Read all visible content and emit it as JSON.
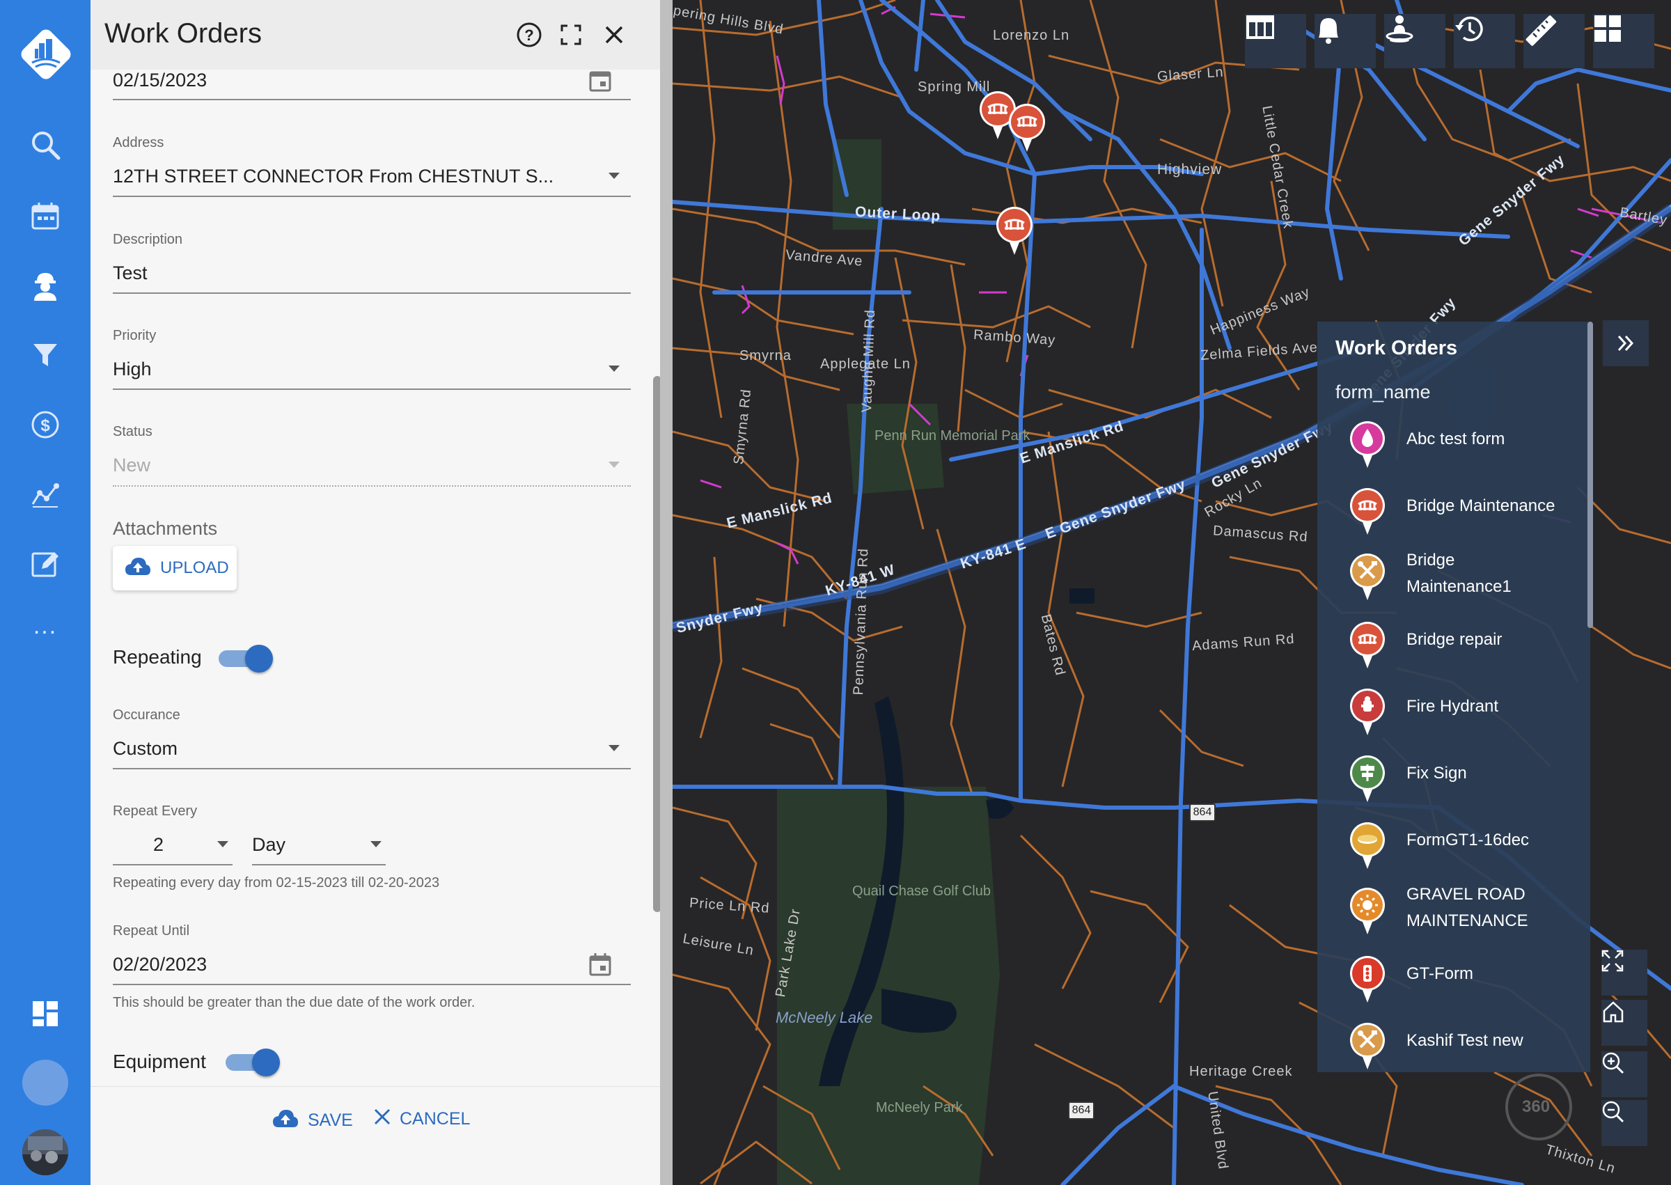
{
  "panel": {
    "title": "Work Orders",
    "due_date": "02/15/2023",
    "address": {
      "label": "Address",
      "value": "12TH STREET CONNECTOR From CHESTNUT S..."
    },
    "description": {
      "label": "Description",
      "value": "Test"
    },
    "priority": {
      "label": "Priority",
      "value": "High"
    },
    "status": {
      "label": "Status",
      "value": "New"
    },
    "attachments": {
      "label": "Attachments",
      "upload_label": "UPLOAD"
    },
    "repeating": {
      "label": "Repeating",
      "on": true
    },
    "occurance": {
      "label": "Occurance",
      "value": "Custom"
    },
    "repeat_every": {
      "label": "Repeat Every",
      "count": "2",
      "unit": "Day",
      "hint": "Repeating every day from 02-15-2023 till 02-20-2023"
    },
    "repeat_until": {
      "label": "Repeat Until",
      "value": "02/20/2023",
      "hint": "This should be greater than the due date of the work order."
    },
    "equipment": {
      "label": "Equipment",
      "on": true
    },
    "save_label": "SAVE",
    "cancel_label": "CANCEL"
  },
  "rail": {
    "icons": [
      "app-logo-icon",
      "search-icon",
      "calendar-icon",
      "worker-icon",
      "filter-icon",
      "dollar-icon",
      "analytics-icon",
      "edit-icon",
      "more-icon",
      "dashboard-icon"
    ],
    "more": "..."
  },
  "map": {
    "labels": {
      "spring_mill": "Spring Mill",
      "lorenzo": "Lorenzo Ln",
      "glaser": "Glaser Ln",
      "highview": "Highview",
      "outer_loop": "Outer Loop",
      "vandre": "Vandre Ave",
      "smyrna": "Smyrna",
      "applegate": "Applegate Ln",
      "rambo": "Rambo Way",
      "happiness": "Happiness Way",
      "zelma": "Zelma Fields Ave",
      "penn_run": "Penn Run Memorial Park",
      "manslick_e": "E Manslick Rd",
      "manslick_w": "E Manslick Rd",
      "gene_snyder": "Gene Snyder Fwy",
      "gene_snyder_2": "Gene Snyder Fwy",
      "gene_snyder_3": "E Gene Snyder Fwy",
      "gene_snyder_4": "Gene Snyder Fwy",
      "ky841": "KY-841 W",
      "ky841_e": "KY-841 E",
      "snyder_fwy": "Snyder Fwy",
      "rocky": "Rocky Ln",
      "damascus": "Damascus Rd",
      "adams_run": "Adams Run Rd",
      "bates": "Bates Rd",
      "pennsylvania": "Pennsylvania Run Rd",
      "vaughn": "Vaughn Mill Rd",
      "smyrna_rd": "Smyrna Rd",
      "quail": "Quail Chase Golf Club",
      "mcneely_lake": "McNeely Lake",
      "mcneely_park": "McNeely Park",
      "heritage": "Heritage Creek",
      "united": "United Blvd",
      "thixton": "Thixton Ln",
      "price": "Price Ln Rd",
      "leisure": "Leisure Ln",
      "park_lake": "Park Lake Dr",
      "little_cedar": "Little Cedar Creek",
      "bartley": "Bartley",
      "pering": "pering Hills Blvd"
    },
    "shields": [
      "864",
      "864"
    ],
    "badge_360": "360"
  },
  "toolbar_icons": [
    "table-icon",
    "bell-icon",
    "location-person-icon",
    "history-icon",
    "ruler-icon",
    "grid-icon"
  ],
  "side_icons": [
    "fullscreen-icon",
    "home-icon",
    "zoom-in-icon",
    "zoom-out-icon"
  ],
  "legend": {
    "title": "Work Orders",
    "subtitle": "form_name",
    "items": [
      {
        "label": "Abc test form",
        "color": "#d63a9c",
        "icon": "drop-icon"
      },
      {
        "label": "Bridge Maintenance",
        "color": "#d9523a",
        "icon": "bridge-icon"
      },
      {
        "label": "Bridge\nMaintenance1",
        "color": "#d99a4a",
        "icon": "tools-icon"
      },
      {
        "label": "Bridge repair",
        "color": "#d9523a",
        "icon": "bridge-icon"
      },
      {
        "label": "Fire Hydrant",
        "color": "#c83c3c",
        "icon": "hydrant-icon"
      },
      {
        "label": "Fix Sign",
        "color": "#4d8a4a",
        "icon": "sign-icon"
      },
      {
        "label": "FormGT1-16dec",
        "color": "#e0a534",
        "icon": "disc-icon"
      },
      {
        "label": "GRAVEL ROAD\nMAINTENANCE",
        "color": "#e48a2a",
        "icon": "sun-icon"
      },
      {
        "label": "GT-Form",
        "color": "#d93a2a",
        "icon": "traffic-light-icon"
      },
      {
        "label": "Kashif Test new",
        "color": "#d99a4a",
        "icon": "tools-icon"
      }
    ]
  },
  "colors": {
    "rail": "#2f7fe0",
    "accent": "#2c6bbf",
    "map_bg": "#262628",
    "minor_road": "#b86c2e",
    "major_road": "#3f78d8"
  }
}
